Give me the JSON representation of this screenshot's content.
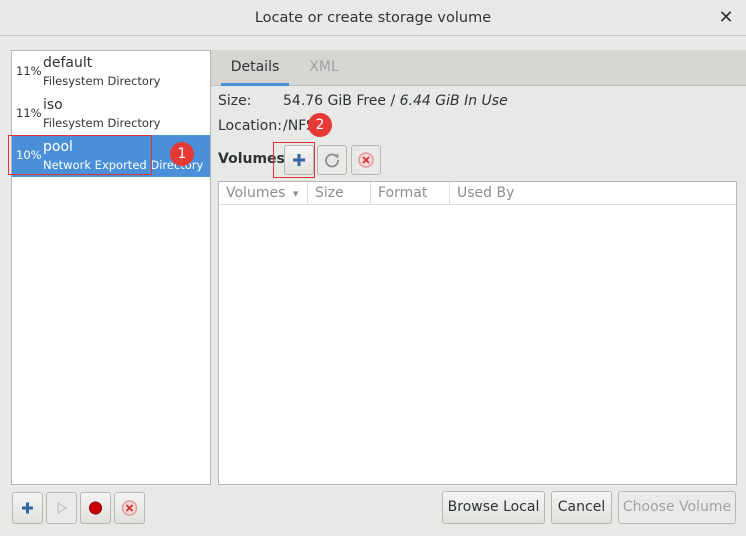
{
  "window": {
    "title": "Locate or create storage volume",
    "close_glyph": "✕"
  },
  "pools": [
    {
      "percent": "11%",
      "name": "default",
      "type": "Filesystem Directory",
      "selected": false
    },
    {
      "percent": "11%",
      "name": "iso",
      "type": "Filesystem Directory",
      "selected": false
    },
    {
      "percent": "10%",
      "name": "pool",
      "type": "Network Exported Directory",
      "selected": true
    }
  ],
  "tabs": {
    "details": "Details",
    "xml": "XML"
  },
  "details": {
    "size_label": "Size:",
    "size_free": "54.76 GiB Free",
    "size_sep": " / ",
    "size_in_use": "6.44 GiB In Use",
    "location_label": "Location:",
    "location_value": "/NFS",
    "volumes_label": "Volumes"
  },
  "volume_table": {
    "columns": [
      "Volumes",
      "Size",
      "Format",
      "Used By"
    ],
    "sort_indicator": "▾",
    "rows": []
  },
  "annotations": {
    "badge1": "1",
    "badge2": "2",
    "color": "#e53935"
  },
  "buttons": {
    "browse_local": "Browse Local",
    "cancel": "Cancel",
    "choose_volume": "Choose Volume"
  },
  "icons": {
    "add": "plus-icon",
    "refresh": "refresh-icon",
    "delete": "delete-icon",
    "start": "play-icon",
    "stop": "record-icon"
  },
  "colors": {
    "selection": "#4a90d9",
    "accent_blue": "#3465a4",
    "stop_red": "#cc0000"
  }
}
